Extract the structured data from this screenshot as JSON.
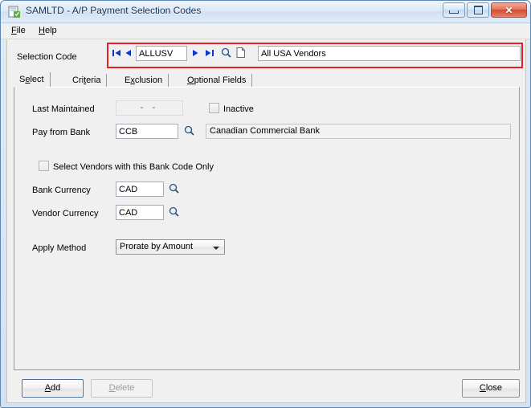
{
  "window": {
    "title": "SAMLTD - A/P Payment Selection Codes",
    "icon": "app-document-icon",
    "controls": {
      "minimize": "minimize-icon",
      "maximize": "maximize-icon",
      "close": "✕"
    }
  },
  "menubar": {
    "items": [
      {
        "label": "File",
        "accel": "F"
      },
      {
        "label": "Help",
        "accel": "H"
      }
    ]
  },
  "selection_code": {
    "label": "Selection Code",
    "code_value": "ALLUSV",
    "description_value": "All USA Vendors",
    "nav": {
      "first": "⏮",
      "previous": "◀",
      "next": "▶",
      "last": "⏭",
      "find": "search-icon",
      "new": "new-document-icon"
    },
    "highlight_color": "#ee1c25"
  },
  "tabs": [
    {
      "label": "Select",
      "accel": "e",
      "active": true
    },
    {
      "label": "Criteria",
      "accel": "t",
      "active": false
    },
    {
      "label": "Exclusion",
      "accel": "x",
      "active": false
    },
    {
      "label": "Optional Fields",
      "accel": "O",
      "active": false
    }
  ],
  "select_tab": {
    "last_maintained": {
      "label": "Last Maintained",
      "value": "-   -"
    },
    "inactive": {
      "label": "Inactive",
      "checked": false
    },
    "pay_from_bank": {
      "label": "Pay from Bank",
      "value": "CCB",
      "description": "Canadian Commercial Bank"
    },
    "select_vendors_bank_only": {
      "label": "Select Vendors with this Bank Code Only",
      "checked": false
    },
    "bank_currency": {
      "label": "Bank Currency",
      "value": "CAD"
    },
    "vendor_currency": {
      "label": "Vendor Currency",
      "value": "CAD"
    },
    "apply_method": {
      "label": "Apply Method",
      "value": "Prorate by Amount"
    }
  },
  "buttons": {
    "add": {
      "label": "Add",
      "accel": "A",
      "enabled": true
    },
    "delete": {
      "label": "Delete",
      "accel": "D",
      "enabled": false
    },
    "close": {
      "label": "Close",
      "accel": "C",
      "enabled": true
    }
  }
}
